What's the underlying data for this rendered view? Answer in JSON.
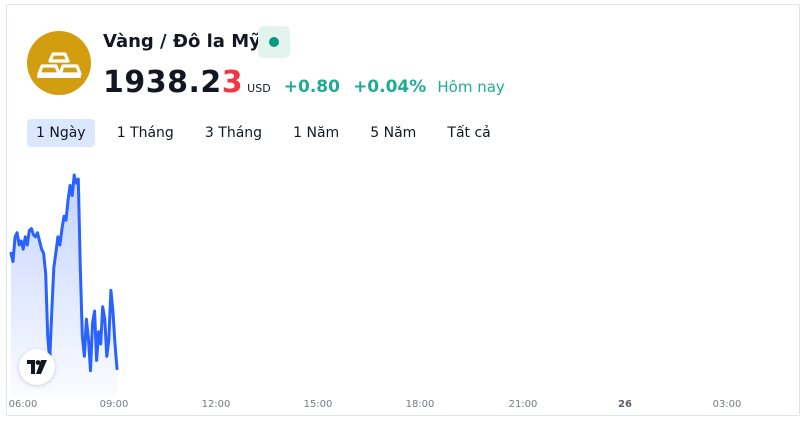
{
  "symbol": {
    "title": "Vàng / Đô la Mỹ",
    "logo_icon": "gold-bars-icon",
    "market_status_icon": "market-open-dot-icon"
  },
  "quote": {
    "price_main": "1938.2",
    "price_last_digit": "3",
    "currency": "USD",
    "change": "+0.80",
    "change_percent": "+0.04%",
    "period": "Hôm nay"
  },
  "ranges": [
    {
      "label": "1 Ngày",
      "active": true
    },
    {
      "label": "1 Tháng",
      "active": false
    },
    {
      "label": "3 Tháng",
      "active": false
    },
    {
      "label": "1 Năm",
      "active": false
    },
    {
      "label": "5 Năm",
      "active": false
    },
    {
      "label": "Tất cả",
      "active": false
    }
  ],
  "time_axis": [
    {
      "label": "06:00",
      "bold": false
    },
    {
      "label": "09:00",
      "bold": false
    },
    {
      "label": "12:00",
      "bold": false
    },
    {
      "label": "15:00",
      "bold": false
    },
    {
      "label": "18:00",
      "bold": false
    },
    {
      "label": "21:00",
      "bold": false
    },
    {
      "label": "26",
      "bold": true
    },
    {
      "label": "03:00",
      "bold": false
    }
  ],
  "colors": {
    "line": "#2962ff",
    "positive": "#22ab94",
    "price_last_digit": "#f23645",
    "logo": "#d39d10",
    "active_tab": "#dbe7fd"
  },
  "chart_data": {
    "type": "area",
    "series_trend": [
      0.62,
      0.58,
      0.7,
      0.72,
      0.66,
      0.68,
      0.64,
      0.7,
      0.66,
      0.73,
      0.74,
      0.71,
      0.7,
      0.72,
      0.68,
      0.64,
      0.62,
      0.52,
      0.22,
      0.1,
      0.34,
      0.55,
      0.62,
      0.7,
      0.66,
      0.74,
      0.8,
      0.78,
      0.88,
      0.95,
      0.9,
      1.0,
      0.96,
      0.98,
      0.55,
      0.22,
      0.12,
      0.3,
      0.2,
      0.05,
      0.28,
      0.34,
      0.1,
      0.24,
      0.18,
      0.36,
      0.3,
      0.12,
      0.2,
      0.44,
      0.34,
      0.18,
      0.06
    ],
    "x_labels": [
      "06:00",
      "09:00",
      "12:00",
      "15:00",
      "18:00",
      "21:00",
      "26",
      "03:00"
    ],
    "grid": false
  },
  "badge": {
    "icon": "tradingview-logo-icon"
  }
}
